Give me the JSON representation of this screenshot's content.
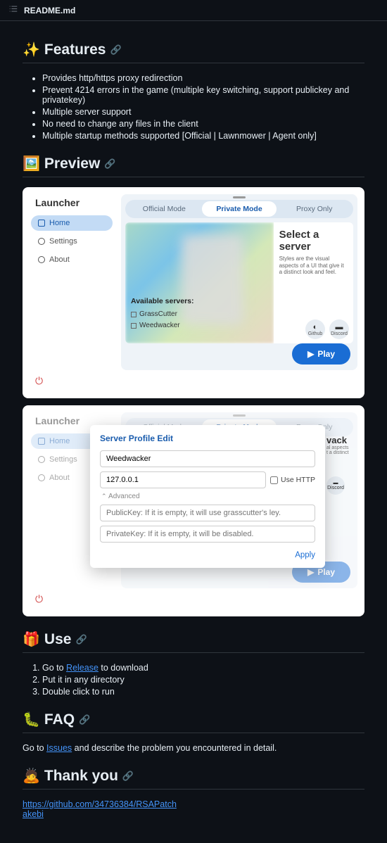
{
  "readme_filename": "README.md",
  "sections": {
    "features": {
      "emoji": "✨",
      "title": "Features",
      "items": [
        "Provides http/https proxy redirection",
        "Prevent 4214 errors in the game (multiple key switching, support publickey and privatekey)",
        "Multiple server support",
        "No need to change any files in the client",
        "Multiple startup methods supported [Official | Lawnmower | Agent only]"
      ]
    },
    "preview": {
      "emoji": "🖼️",
      "title": "Preview"
    },
    "use": {
      "emoji": "🎁",
      "title": "Use",
      "steps_prefix": [
        "Go to ",
        "Put it in any directory",
        "Double click to run"
      ],
      "release_link": "Release",
      "release_suffix": " to download"
    },
    "faq": {
      "emoji": "🐛",
      "title": "FAQ",
      "text_prefix": "Go to ",
      "issues_link": "Issues",
      "text_suffix": " and describe the problem you encountered in detail."
    },
    "thankyou": {
      "emoji": "🙇",
      "title": "Thank you",
      "links": [
        "https://github.com/34736384/RSAPatch",
        "akebi"
      ]
    }
  },
  "launcher": {
    "title": "Launcher",
    "nav": {
      "home": "Home",
      "settings": "Settings",
      "about": "About"
    },
    "tabs": {
      "official": "Official Mode",
      "private": "Private Mode",
      "proxy": "Proxy Only"
    },
    "select_title": "Select a server",
    "select_desc": "Styles are the visual aspects of a UI that give it a distinct look and feel.",
    "avail_label": "Available servers:",
    "servers": [
      "GrassCutter",
      "Weedwacker"
    ],
    "github": "Github",
    "discord": "Discord",
    "play": "Play"
  },
  "modal": {
    "title": "Server Profile Edit",
    "name_value": "Weedwacker",
    "ip_value": "127.0.0.1",
    "use_http": "Use HTTP",
    "advanced": "Advanced",
    "pubkey_placeholder": "PublicKey: If it is empty, it will use grasscutter's ley.",
    "privkey_placeholder": "PrivateKey: If it is empty, it will be disabled.",
    "apply": "Apply",
    "peek_title": "vack"
  }
}
